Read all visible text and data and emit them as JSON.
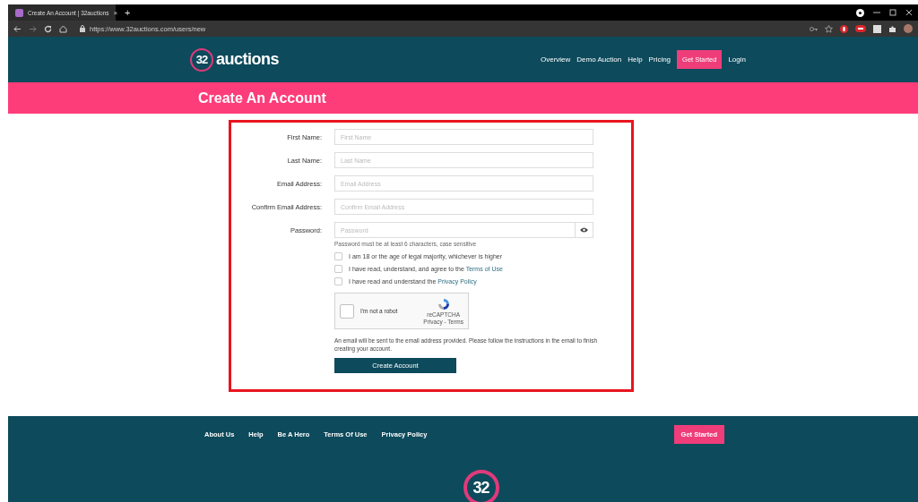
{
  "browser": {
    "tab": {
      "title": "Create An Account | 32auctions",
      "close": "×"
    },
    "new_tab": "+",
    "url": "https://www.32auctions.com/users/new"
  },
  "header": {
    "logo": {
      "mark": "32",
      "word": "auctions"
    },
    "nav": [
      {
        "label": "Overview",
        "kind": "link"
      },
      {
        "label": "Demo Auction",
        "kind": "link"
      },
      {
        "label": "Help",
        "kind": "link"
      },
      {
        "label": "Pricing",
        "kind": "link"
      },
      {
        "label": "Get Started",
        "kind": "button"
      },
      {
        "label": "Login",
        "kind": "link"
      }
    ]
  },
  "page_title": "Create An Account",
  "form": {
    "fields": [
      {
        "label": "First Name:",
        "placeholder": "First Name",
        "kind": "text"
      },
      {
        "label": "Last Name:",
        "placeholder": "Last Name",
        "kind": "text"
      },
      {
        "label": "Email Address:",
        "placeholder": "Email Address",
        "kind": "text"
      },
      {
        "label": "Confirm Email Address:",
        "placeholder": "Confirm Email Address",
        "kind": "text"
      },
      {
        "label": "Password:",
        "placeholder": "Password",
        "kind": "password",
        "hint": "Password must be at least 6 characters, case sensitive"
      }
    ],
    "agreements": [
      {
        "text": "I am 18 or the age of legal majority, whichever is higher",
        "checked": false
      },
      {
        "text": "I have read, understand, and agree to the ",
        "link": "Terms of Use",
        "checked": false
      },
      {
        "text": "I have read and understand the ",
        "link": "Privacy Policy",
        "checked": false
      }
    ],
    "captcha": {
      "label": "I'm not a robot",
      "brand": "reCAPTCHA",
      "links": "Privacy - Terms",
      "checked": false
    },
    "note": "An email will be sent to the email address provided. Please follow the instructions in the email to finish creating your account.",
    "submit": "Create Account"
  },
  "footer": {
    "links": [
      "About Us",
      "Help",
      "Be A Hero",
      "Terms Of Use",
      "Privacy Policy"
    ],
    "button": "Get Started",
    "logo": "32"
  }
}
